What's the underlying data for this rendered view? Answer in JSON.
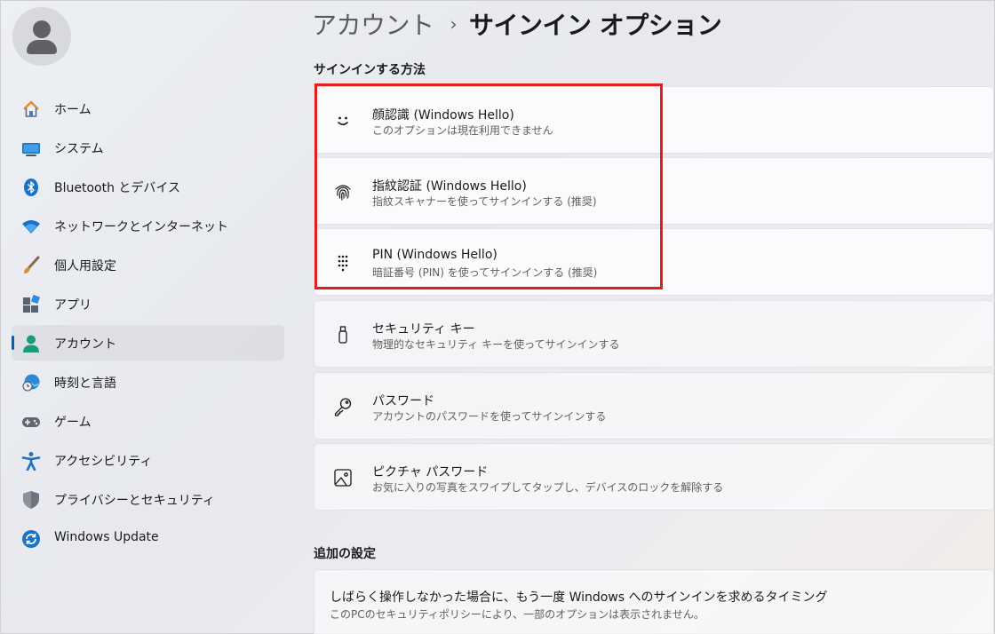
{
  "breadcrumb": {
    "parent": "アカウント",
    "separator": "›",
    "current": "サインイン オプション"
  },
  "sidebar": {
    "items": [
      {
        "label": "ホーム",
        "icon": "home-icon",
        "active": false
      },
      {
        "label": "システム",
        "icon": "system-icon",
        "active": false
      },
      {
        "label": "Bluetooth とデバイス",
        "icon": "bluetooth-icon",
        "active": false
      },
      {
        "label": "ネットワークとインターネット",
        "icon": "wifi-icon",
        "active": false
      },
      {
        "label": "個人用設定",
        "icon": "brush-icon",
        "active": false
      },
      {
        "label": "アプリ",
        "icon": "apps-icon",
        "active": false
      },
      {
        "label": "アカウント",
        "icon": "account-icon",
        "active": true
      },
      {
        "label": "時刻と言語",
        "icon": "time-language-icon",
        "active": false
      },
      {
        "label": "ゲーム",
        "icon": "gamepad-icon",
        "active": false
      },
      {
        "label": "アクセシビリティ",
        "icon": "accessibility-icon",
        "active": false
      },
      {
        "label": "プライバシーとセキュリティ",
        "icon": "shield-icon",
        "active": false
      },
      {
        "label": "Windows Update",
        "icon": "windows-update-icon",
        "active": false
      }
    ]
  },
  "signin": {
    "heading": "サインインする方法",
    "options": [
      {
        "title": "顔認識 (Windows Hello)",
        "subtitle": "このオプションは現在利用できません",
        "icon": "face-icon"
      },
      {
        "title": "指紋認証 (Windows Hello)",
        "subtitle": "指紋スキャナーを使ってサインインする (推奨)",
        "icon": "fingerprint-icon"
      },
      {
        "title": "PIN (Windows Hello)",
        "subtitle": "暗証番号 (PIN) を使ってサインインする (推奨)",
        "icon": "pin-keypad-icon"
      },
      {
        "title": "セキュリティ キー",
        "subtitle": "物理的なセキュリティ キーを使ってサインインする",
        "icon": "usb-key-icon"
      },
      {
        "title": "パスワード",
        "subtitle": "アカウントのパスワードを使ってサインインする",
        "icon": "key-icon"
      },
      {
        "title": "ピクチャ パスワード",
        "subtitle": "お気に入りの写真をスワイプしてタップし、デバイスのロックを解除する",
        "icon": "picture-icon"
      }
    ]
  },
  "additional": {
    "heading": "追加の設定",
    "title": "しばらく操作しなかった場合に、もう一度 Windows へのサインインを求めるタイミング",
    "subtitle": "このPCのセキュリティポリシーにより、一部のオプションは表示されません。"
  },
  "colors": {
    "accent": "#005fb8",
    "highlight": "#e31e1e"
  }
}
